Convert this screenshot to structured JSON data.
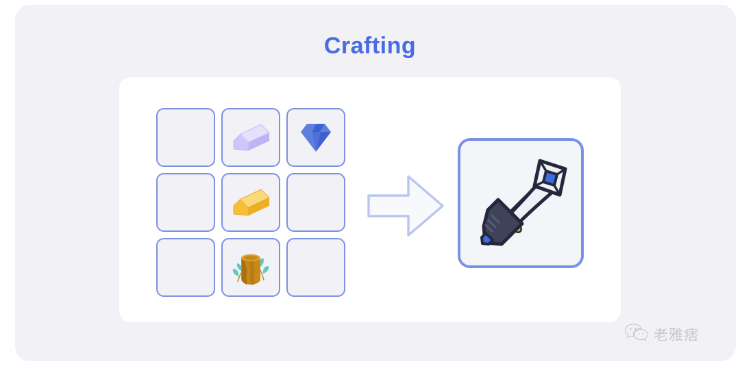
{
  "page": {
    "title": "Crafting",
    "title_color": "#4a6ce0",
    "background_color": "#ffffff",
    "panel_color": "#f1f1f6",
    "card_color": "#ffffff"
  },
  "colors": {
    "cell_border": "#7b92e0",
    "cell_fill": "#f1f1f6",
    "result_border": "#7b92e0",
    "result_fill": "#f4f5f9",
    "arrow_stroke": "#b9c6ef",
    "arrow_fill": "#f6f7fc",
    "silver_ingot": "#cdc6f7",
    "gem_blue": "#4a6cd4",
    "gold_ingot": "#f5c646",
    "wood_brown": "#c8881a",
    "leaf_teal": "#5fc8c0",
    "sword_blade": "#f0f0f7",
    "sword_handle": "#3e4359",
    "sword_guard": "#f0c040",
    "sword_gem": "#3b6fe0"
  },
  "grid": {
    "rows": 3,
    "columns": 3,
    "cells": [
      {
        "index": 0,
        "row": 1,
        "col": 1,
        "item": null,
        "label": "empty-slot"
      },
      {
        "index": 1,
        "row": 1,
        "col": 2,
        "item": "silver-ingot",
        "label": "Silver Ingot"
      },
      {
        "index": 2,
        "row": 1,
        "col": 3,
        "item": "diamond-gem",
        "label": "Diamond"
      },
      {
        "index": 3,
        "row": 2,
        "col": 1,
        "item": null,
        "label": "empty-slot"
      },
      {
        "index": 4,
        "row": 2,
        "col": 2,
        "item": "gold-ingot",
        "label": "Gold Ingot"
      },
      {
        "index": 5,
        "row": 2,
        "col": 3,
        "item": null,
        "label": "empty-slot"
      },
      {
        "index": 6,
        "row": 3,
        "col": 1,
        "item": null,
        "label": "empty-slot"
      },
      {
        "index": 7,
        "row": 3,
        "col": 2,
        "item": "wood-log",
        "label": "Wood Log"
      },
      {
        "index": 8,
        "row": 3,
        "col": 3,
        "item": null,
        "label": "empty-slot"
      }
    ]
  },
  "arrow": {
    "icon": "arrow-right-icon",
    "direction": "right"
  },
  "result": {
    "item": "sword",
    "label": "Sword"
  },
  "watermark": {
    "icon": "wechat-icon",
    "text": "老雅痞"
  }
}
